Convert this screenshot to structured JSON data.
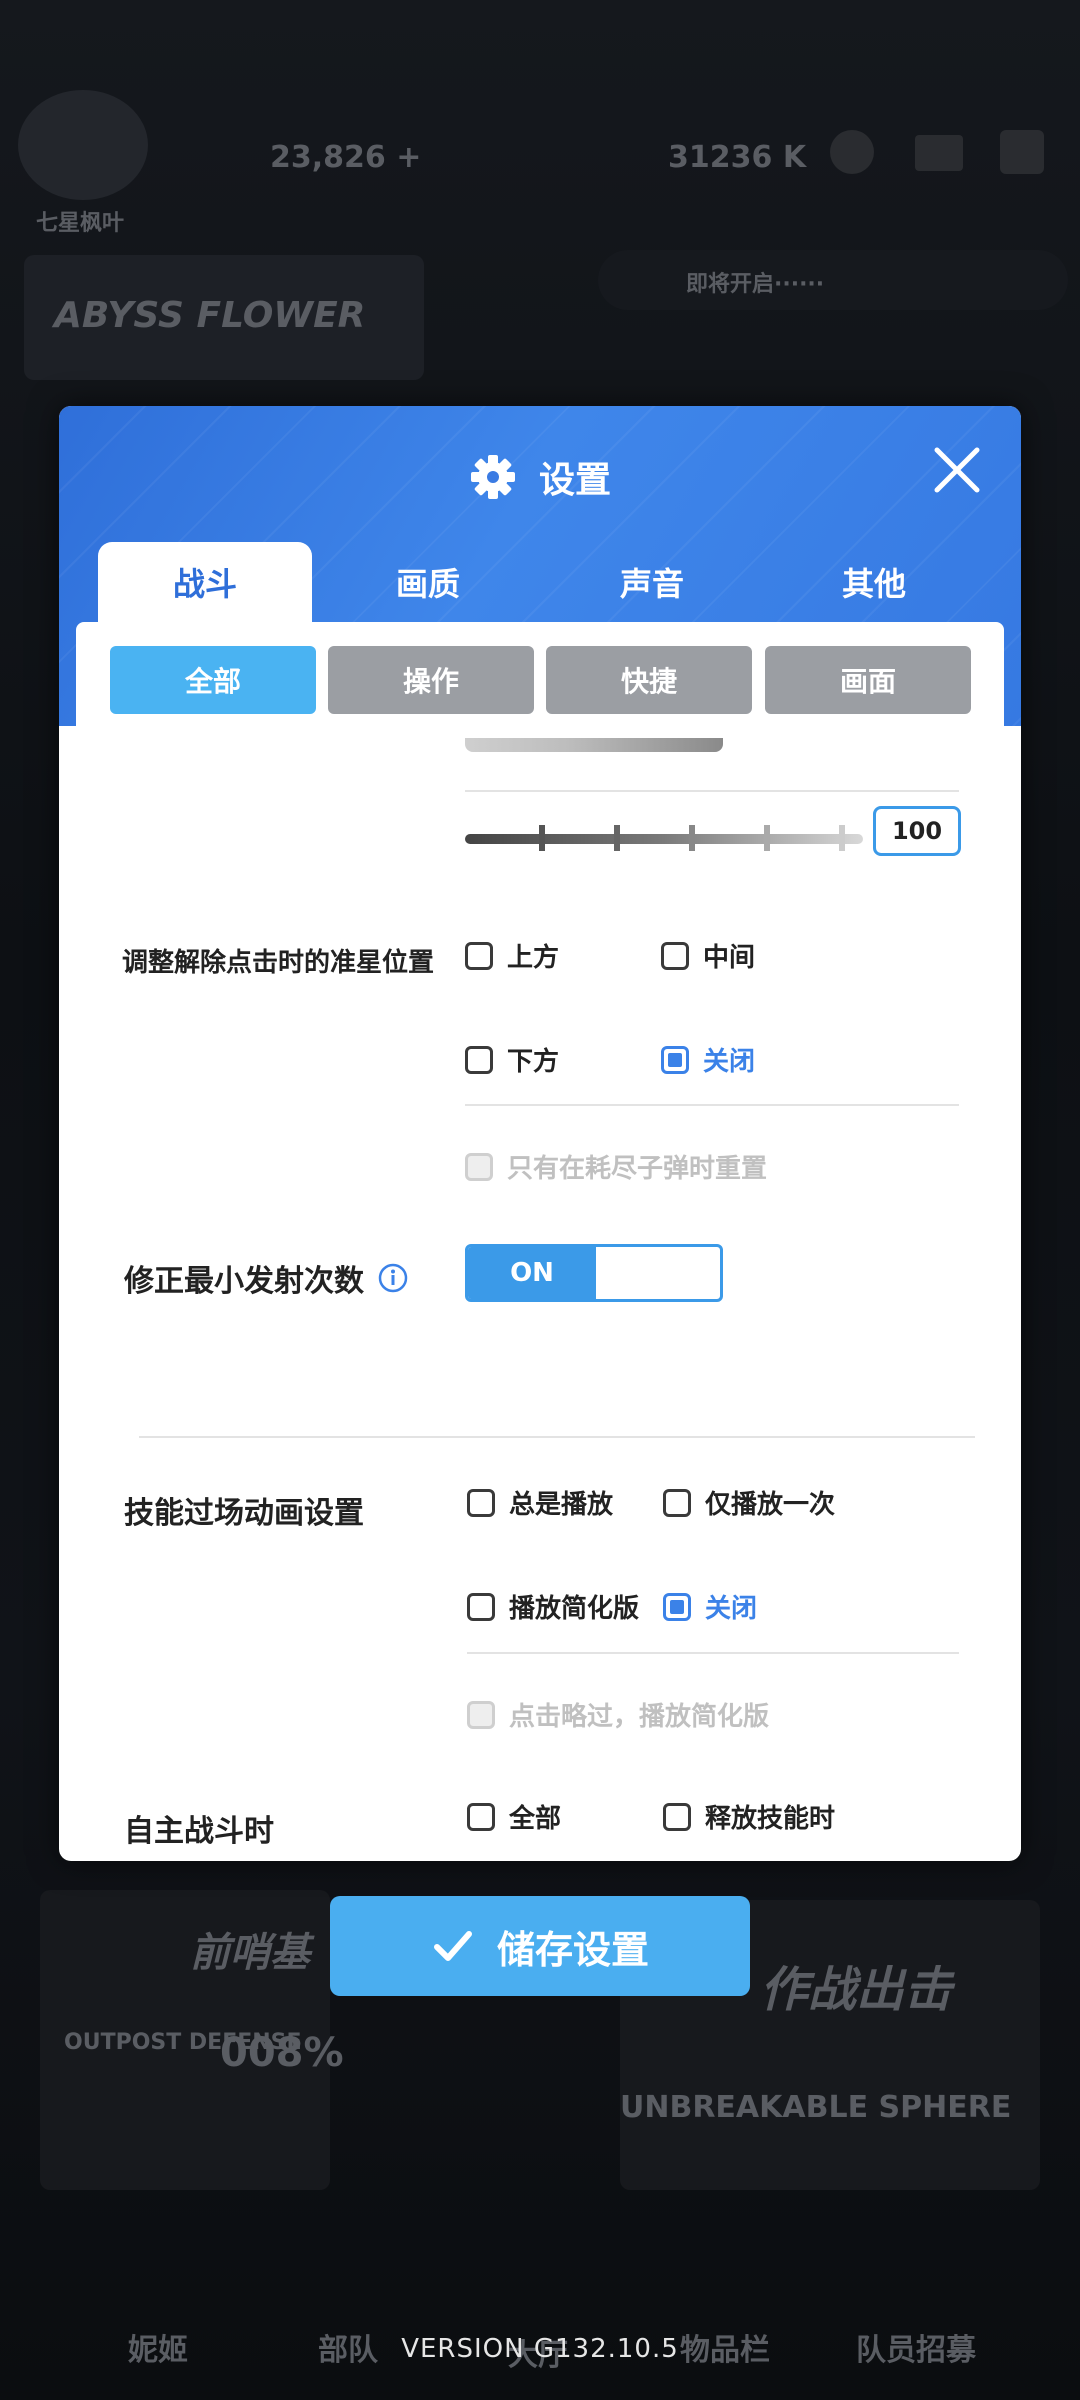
{
  "background": {
    "player_name": "七星枫叶",
    "stat1": "23,826 +",
    "stat2": "31236 K",
    "banner_text": "即将开启······",
    "abyss_text": "ABYSS FLOWER",
    "event_text1": "前哨基",
    "event_text2": "作战出击",
    "outpost_text": "OUTPOST DEFENSE",
    "outpost_pct": "008%",
    "unbreakable_text": "UNBREAKABLE SPHERE",
    "nav": [
      "妮姬",
      "部队",
      "大厅",
      "物品栏",
      "队员招募"
    ]
  },
  "modal": {
    "title": "设置",
    "tabs": [
      "战斗",
      "画质",
      "声音",
      "其他"
    ],
    "subtabs": [
      "全部",
      "操作",
      "快捷",
      "画面"
    ],
    "slider_value": "100",
    "aim_label": "调整解除点击时的准星位置",
    "aim_options": [
      "上方",
      "中间",
      "下方",
      "关闭"
    ],
    "reset_only_label": "只有在耗尽子弹时重置",
    "min_fire_label": "修正最小发射次数",
    "toggle_on": "ON",
    "skill_anim_label": "技能过场动画设置",
    "skill_anim_options": [
      "总是播放",
      "仅播放一次",
      "播放简化版",
      "关闭"
    ],
    "skip_label": "点击略过，播放简化版",
    "auto_label": "自主战斗时",
    "auto_options": [
      "全部",
      "释放技能时"
    ]
  },
  "save_label": "储存设置",
  "version": "VERSION   G132.10.5",
  "colors": {
    "accent": "#3b82e8",
    "header": "#2f6fd9",
    "save": "#4aaef0"
  }
}
